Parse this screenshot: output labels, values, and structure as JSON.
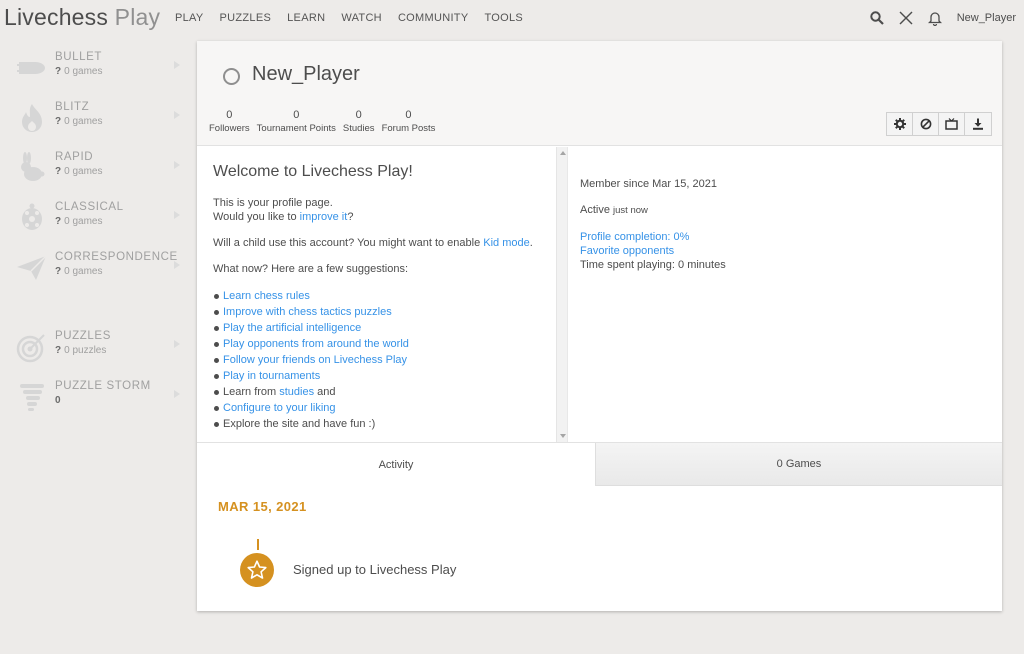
{
  "header": {
    "logo_main": "Livechess",
    "logo_suffix": " Play",
    "nav": [
      "PLAY",
      "PUZZLES",
      "LEARN",
      "WATCH",
      "COMMUNITY",
      "TOOLS"
    ],
    "username": "New_Player"
  },
  "sidebar": {
    "items": [
      {
        "name": "BULLET",
        "mark": "?",
        "sub": "0 games",
        "icon": "bullet-icon"
      },
      {
        "name": "BLITZ",
        "mark": "?",
        "sub": "0 games",
        "icon": "fire-icon"
      },
      {
        "name": "RAPID",
        "mark": "?",
        "sub": "0 games",
        "icon": "rabbit-icon"
      },
      {
        "name": "CLASSICAL",
        "mark": "?",
        "sub": "0 games",
        "icon": "turtle-icon"
      },
      {
        "name": "CORRESPONDENCE",
        "mark": "?",
        "sub": "0 games",
        "icon": "paper-plane-icon"
      },
      {
        "name": "PUZZLES",
        "mark": "?",
        "sub": "0 puzzles",
        "icon": "target-icon"
      },
      {
        "name": "PUZZLE STORM",
        "mark": "0",
        "sub": "",
        "icon": "tornado-icon"
      }
    ]
  },
  "profile": {
    "name": "New_Player",
    "stats": [
      {
        "value": "0",
        "label": "Followers"
      },
      {
        "value": "0",
        "label": "Tournament Points"
      },
      {
        "value": "0",
        "label": "Studies"
      },
      {
        "value": "0",
        "label": "Forum Posts"
      }
    ]
  },
  "welcome": {
    "title": "Welcome to Livechess Play!",
    "line1": "This is your profile page.",
    "line2_pre": "Would you like to ",
    "line2_link": "improve it",
    "line2_post": "?",
    "kid_pre": "Will a child use this account? You might want to enable ",
    "kid_link": "Kid mode",
    "kid_post": ".",
    "suggest": "What now? Here are a few suggestions:",
    "list": {
      "l1": "Learn chess rules",
      "l2": "Improve with chess tactics puzzles",
      "l3": "Play the artificial intelligence",
      "l4": "Play opponents from around the world",
      "l5": "Follow your friends on Livechess Play",
      "l6": "Play in tournaments",
      "l7_pre": "Learn from ",
      "l7_link": "studies",
      "l7_post": " and",
      "l8": "Configure to your liking",
      "l9": "Explore the site and have fun :)"
    }
  },
  "info": {
    "member_since": "Member since Mar 15, 2021",
    "active": "Active",
    "active_when": "just now",
    "completion": "Profile completion: 0%",
    "favorites": "Favorite opponents",
    "time_played": "Time spent playing: 0 minutes"
  },
  "tabs": {
    "activity": "Activity",
    "games": "0 Games"
  },
  "activity": {
    "date": "MAR 15, 2021",
    "event": "Signed up to Livechess Play"
  },
  "colors": {
    "accent": "#d59120",
    "link": "#3692e7"
  }
}
